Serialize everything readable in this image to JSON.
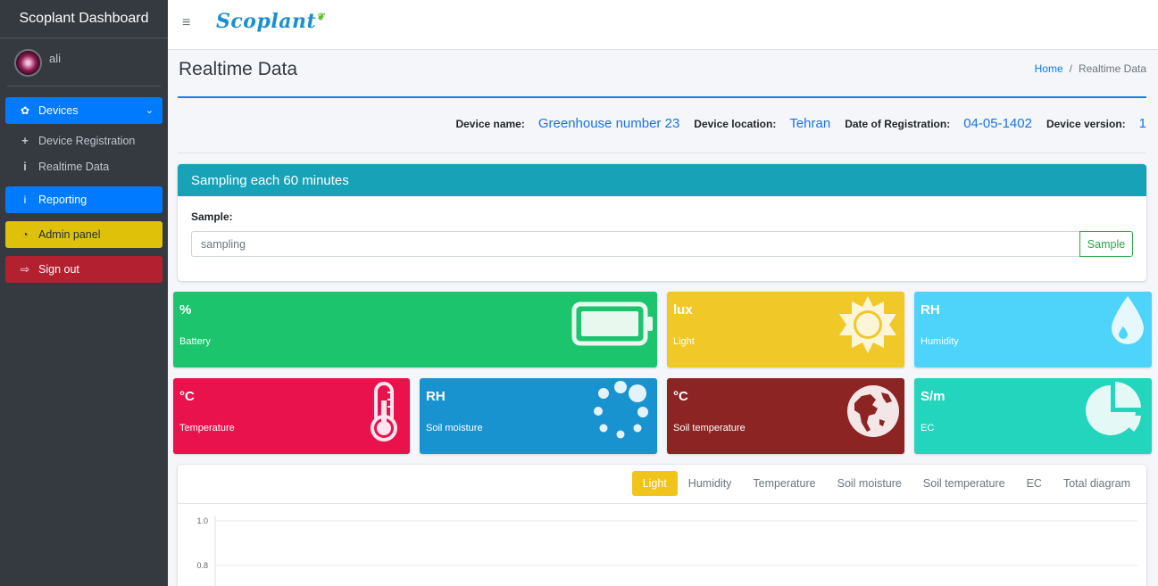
{
  "sidebar": {
    "brand": "Scoplant Dashboard",
    "user": "ali",
    "items": [
      {
        "label": "Devices",
        "icon": "gear-icon"
      },
      {
        "label": "Device Registration",
        "icon": "plus-icon"
      },
      {
        "label": "Realtime Data",
        "icon": "info-icon"
      },
      {
        "label": "Reporting",
        "icon": "info-icon"
      },
      {
        "label": "Admin panel",
        "icon": "tachometer-icon"
      },
      {
        "label": "Sign out",
        "icon": "sign-out-icon"
      }
    ]
  },
  "topbar": {
    "logo": "Scoplant",
    "menu_icon": "hamburger-icon"
  },
  "header": {
    "title": "Realtime Data",
    "breadcrumb": {
      "home": "Home",
      "separator": "/",
      "current": "Realtime Data"
    }
  },
  "device": {
    "name_label": "Device name:",
    "name": "Greenhouse number 23",
    "location_label": "Device location:",
    "location": "Tehran",
    "registration_label": "Date of Registration:",
    "registration": "04-05-1402",
    "version_label": "Device version:",
    "version": "1"
  },
  "sampling": {
    "title": "Sampling each 60 minutes",
    "label": "Sample:",
    "input_value": "sampling",
    "button": "Sample"
  },
  "boxes": [
    {
      "unit": "%",
      "name": "Battery",
      "icon": "battery-icon",
      "color": "#1cc46e"
    },
    {
      "unit": "lux",
      "name": "Light",
      "icon": "sun-icon",
      "color": "#f0c929"
    },
    {
      "unit": "RH",
      "name": "Humidity",
      "icon": "droplet-icon",
      "color": "#4ed3fb"
    },
    {
      "unit": "°C",
      "name": "Temperature",
      "icon": "thermometer-icon",
      "color": "#e9124d"
    },
    {
      "unit": "RH",
      "name": "Soil moisture",
      "icon": "spinner-icon",
      "color": "#1993d0"
    },
    {
      "unit": "°C",
      "name": "Soil temperature",
      "icon": "globe-icon",
      "color": "#8c2424"
    },
    {
      "unit": "S/m",
      "name": "EC",
      "icon": "pie-chart-icon",
      "color": "#24d5bd"
    }
  ],
  "chart": {
    "tabs": [
      "Light",
      "Humidity",
      "Temperature",
      "Soil moisture",
      "Soil temperature",
      "EC",
      "Total diagram"
    ],
    "active_tab": "Light",
    "active_color": "#f0c419"
  },
  "chart_data": {
    "type": "line",
    "y_ticks": [
      "1.0",
      "0.8"
    ],
    "series": []
  }
}
